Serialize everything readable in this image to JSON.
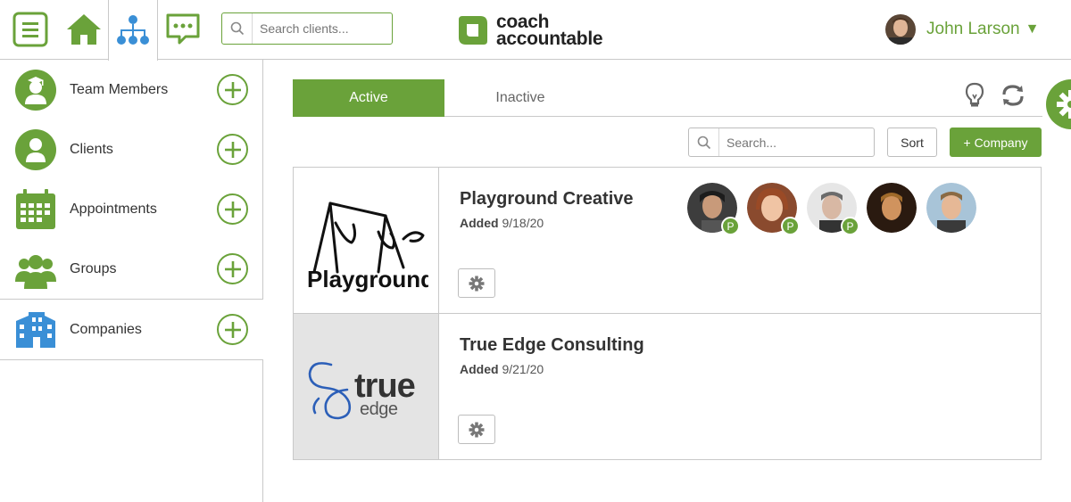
{
  "header": {
    "search_placeholder": "Search clients...",
    "logo_line1": "coach",
    "logo_line2": "accountable",
    "user_name": "John Larson",
    "user_caret": "▼"
  },
  "sidebar": {
    "items": [
      {
        "label": "Team Members",
        "icon": "team-members-icon"
      },
      {
        "label": "Clients",
        "icon": "client-icon"
      },
      {
        "label": "Appointments",
        "icon": "calendar-icon"
      },
      {
        "label": "Groups",
        "icon": "groups-icon"
      },
      {
        "label": "Companies",
        "icon": "building-icon"
      }
    ]
  },
  "tabs": {
    "active": "Active",
    "inactive": "Inactive"
  },
  "toolbar": {
    "search_placeholder": "Search...",
    "sort_label": "Sort",
    "add_company_label": "+ Company"
  },
  "companies": [
    {
      "name": "Playground Creative",
      "added_label": "Added",
      "added_date": "9/18/20",
      "logo_text": "Playground",
      "members": [
        {
          "badge": "P"
        },
        {
          "badge": "P"
        },
        {
          "badge": "P"
        },
        {
          "badge": ""
        },
        {
          "badge": ""
        }
      ]
    },
    {
      "name": "True Edge Consulting",
      "added_label": "Added",
      "added_date": "9/21/20",
      "logo_text_main": "true",
      "logo_text_sub": "edge",
      "members": []
    }
  ],
  "colors": {
    "accent": "#6aa23a",
    "companies_icon": "#3a8fd6"
  }
}
